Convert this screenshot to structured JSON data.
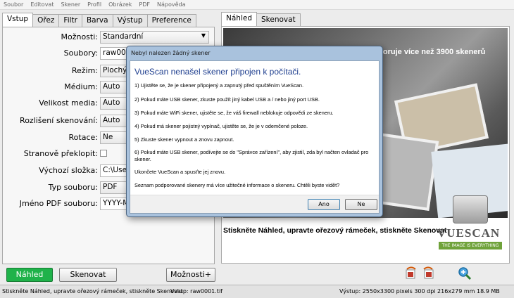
{
  "menu": [
    "Soubor",
    "Editovat",
    "Skener",
    "Profil",
    "Obrázek",
    "PDF",
    "Nápověda"
  ],
  "left_tabs": [
    {
      "label": "Vstup",
      "active": true
    },
    {
      "label": "Ořez",
      "active": false
    },
    {
      "label": "Filtr",
      "active": false
    },
    {
      "label": "Barva",
      "active": false
    },
    {
      "label": "Výstup",
      "active": false
    },
    {
      "label": "Preference",
      "active": false
    }
  ],
  "settings": {
    "moznosti": {
      "label": "Možnosti:",
      "value": "Standardní"
    },
    "soubory": {
      "label": "Soubory:",
      "value": "raw0001.tif"
    },
    "rezim": {
      "label": "Režim:",
      "value": "Plochý"
    },
    "medium": {
      "label": "Médium:",
      "value": "Auto"
    },
    "velikost": {
      "label": "Velikost media:",
      "value": "Auto"
    },
    "rozliseni": {
      "label": "Rozlišení skenování:",
      "value": "Auto"
    },
    "rotace": {
      "label": "Rotace:",
      "value": "Ne"
    },
    "stranove": {
      "label": "Stranově překlopit:",
      "checked": false
    },
    "slozka": {
      "label": "Výchozí složka:",
      "value": "C:\\Users"
    },
    "typ": {
      "label": "Typ souboru:",
      "value": "PDF"
    },
    "jmeno": {
      "label": "Jméno PDF souboru:",
      "value": "YYYY-MM"
    }
  },
  "right_tabs": [
    {
      "label": "Náhled",
      "active": true
    },
    {
      "label": "Skenovat",
      "active": false
    }
  ],
  "preview": {
    "headline": "podporuje více než 3900 skenerů",
    "prompt": "Stiskněte Náhled, upravte ořezový rámeček, stiskněte Skenovat",
    "logo_word": "VUESCAN",
    "logo_tagline": "THE IMAGE IS EVERYTHING"
  },
  "buttons": {
    "preview": "Náhled",
    "scan": "Skenovat",
    "more": "Možnosti+"
  },
  "statusbar": {
    "left": "Stiskněte Náhled, upravte ořezový rámeček, stiskněte Skenovat",
    "middle": "Vstup: raw0001.tif",
    "right": "Výstup: 2550x3300 pixels 300 dpi 216x279 mm 18.9 MB"
  },
  "dialog": {
    "title": "Nebyl nalezen žádný skener",
    "heading": "VueScan nenašel skener připojen k počítači.",
    "lines": [
      "1) Ujistěte se, že je skener připojený a zapnutý před spuštěním VueScan.",
      "2) Pokud máte USB skener, zkuste použít jiný kabel USB a / nebo jiný port USB.",
      "3) Pokud máte WiFi skener, ujistěte se, že váš firewall neblokuje odpovědi ze skeneru.",
      "4) Pokud má skener pojistný vypínač, ujistěte se, že je v odemčené poloze.",
      "5) Zkuste skener vypnout a znovu zapnout.",
      "6) Pokud máte USB skener, podívejte se do \"Správce zařízení\", aby zjistil, zda byl načten ovladač pro skener.",
      "Ukončete VueScan a spusťte jej znovu.",
      "Seznam podporované skenery má více užitečné informace o skeneru. Chtěli byste vidět?"
    ],
    "yes": "Ano",
    "no": "Ne"
  }
}
